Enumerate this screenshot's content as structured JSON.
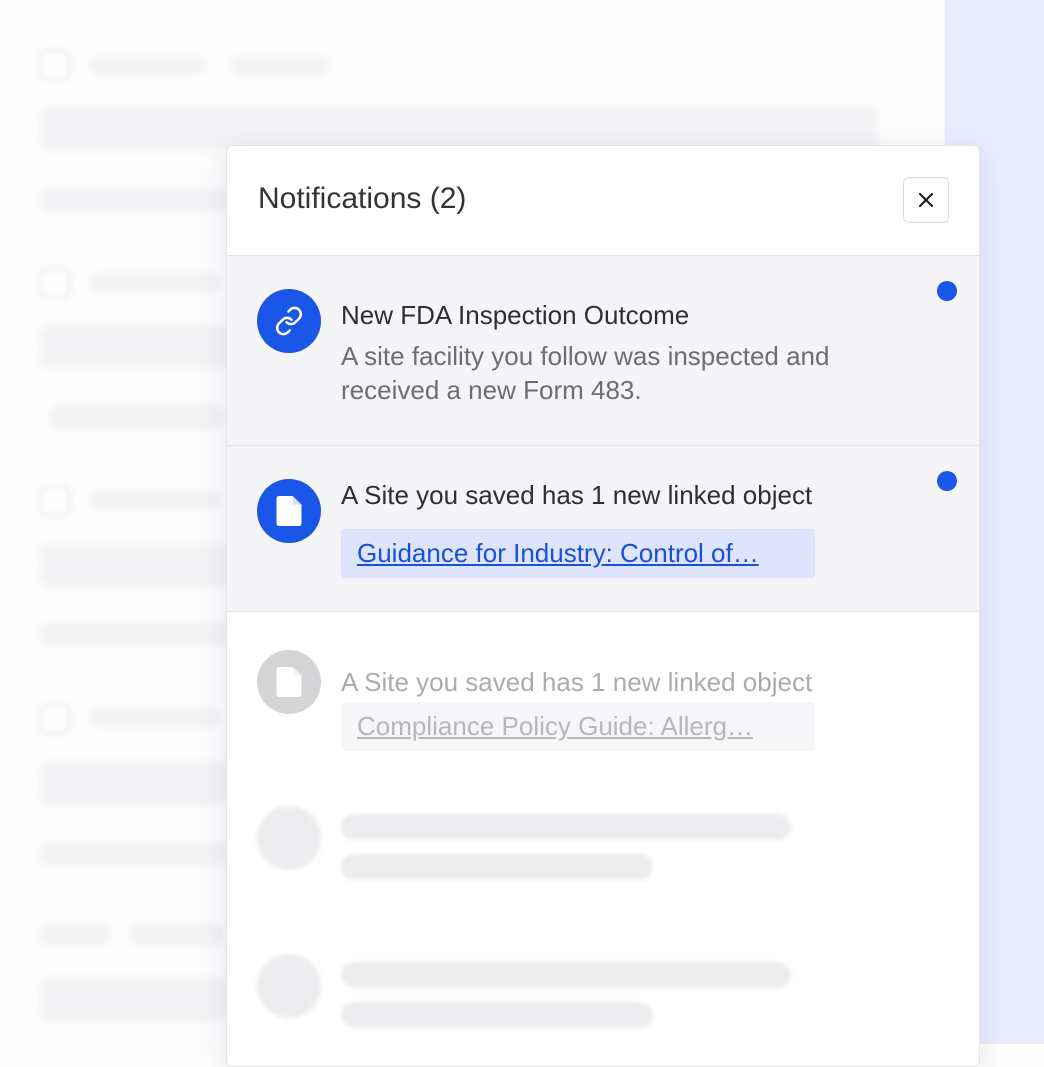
{
  "panel": {
    "title": "Notifications (2)",
    "close_icon": "close-icon"
  },
  "notifications": [
    {
      "icon": "link-icon",
      "title": "New FDA Inspection Outcome",
      "body": "A site facility you follow was inspected and received a new Form 483.",
      "unread": true
    },
    {
      "icon": "document-icon",
      "title": "A Site you saved has 1 new linked object",
      "link": "Guidance for Industry: Control of…",
      "unread": true
    },
    {
      "icon": "document-icon",
      "title": "A Site you saved has 1 new linked object",
      "link": "Compliance Policy Guide: Allerg…",
      "unread": false
    }
  ],
  "colors": {
    "accent": "#1a56e8",
    "link_chip": "#dde5fc",
    "side_strip": "#e8ecfd"
  }
}
